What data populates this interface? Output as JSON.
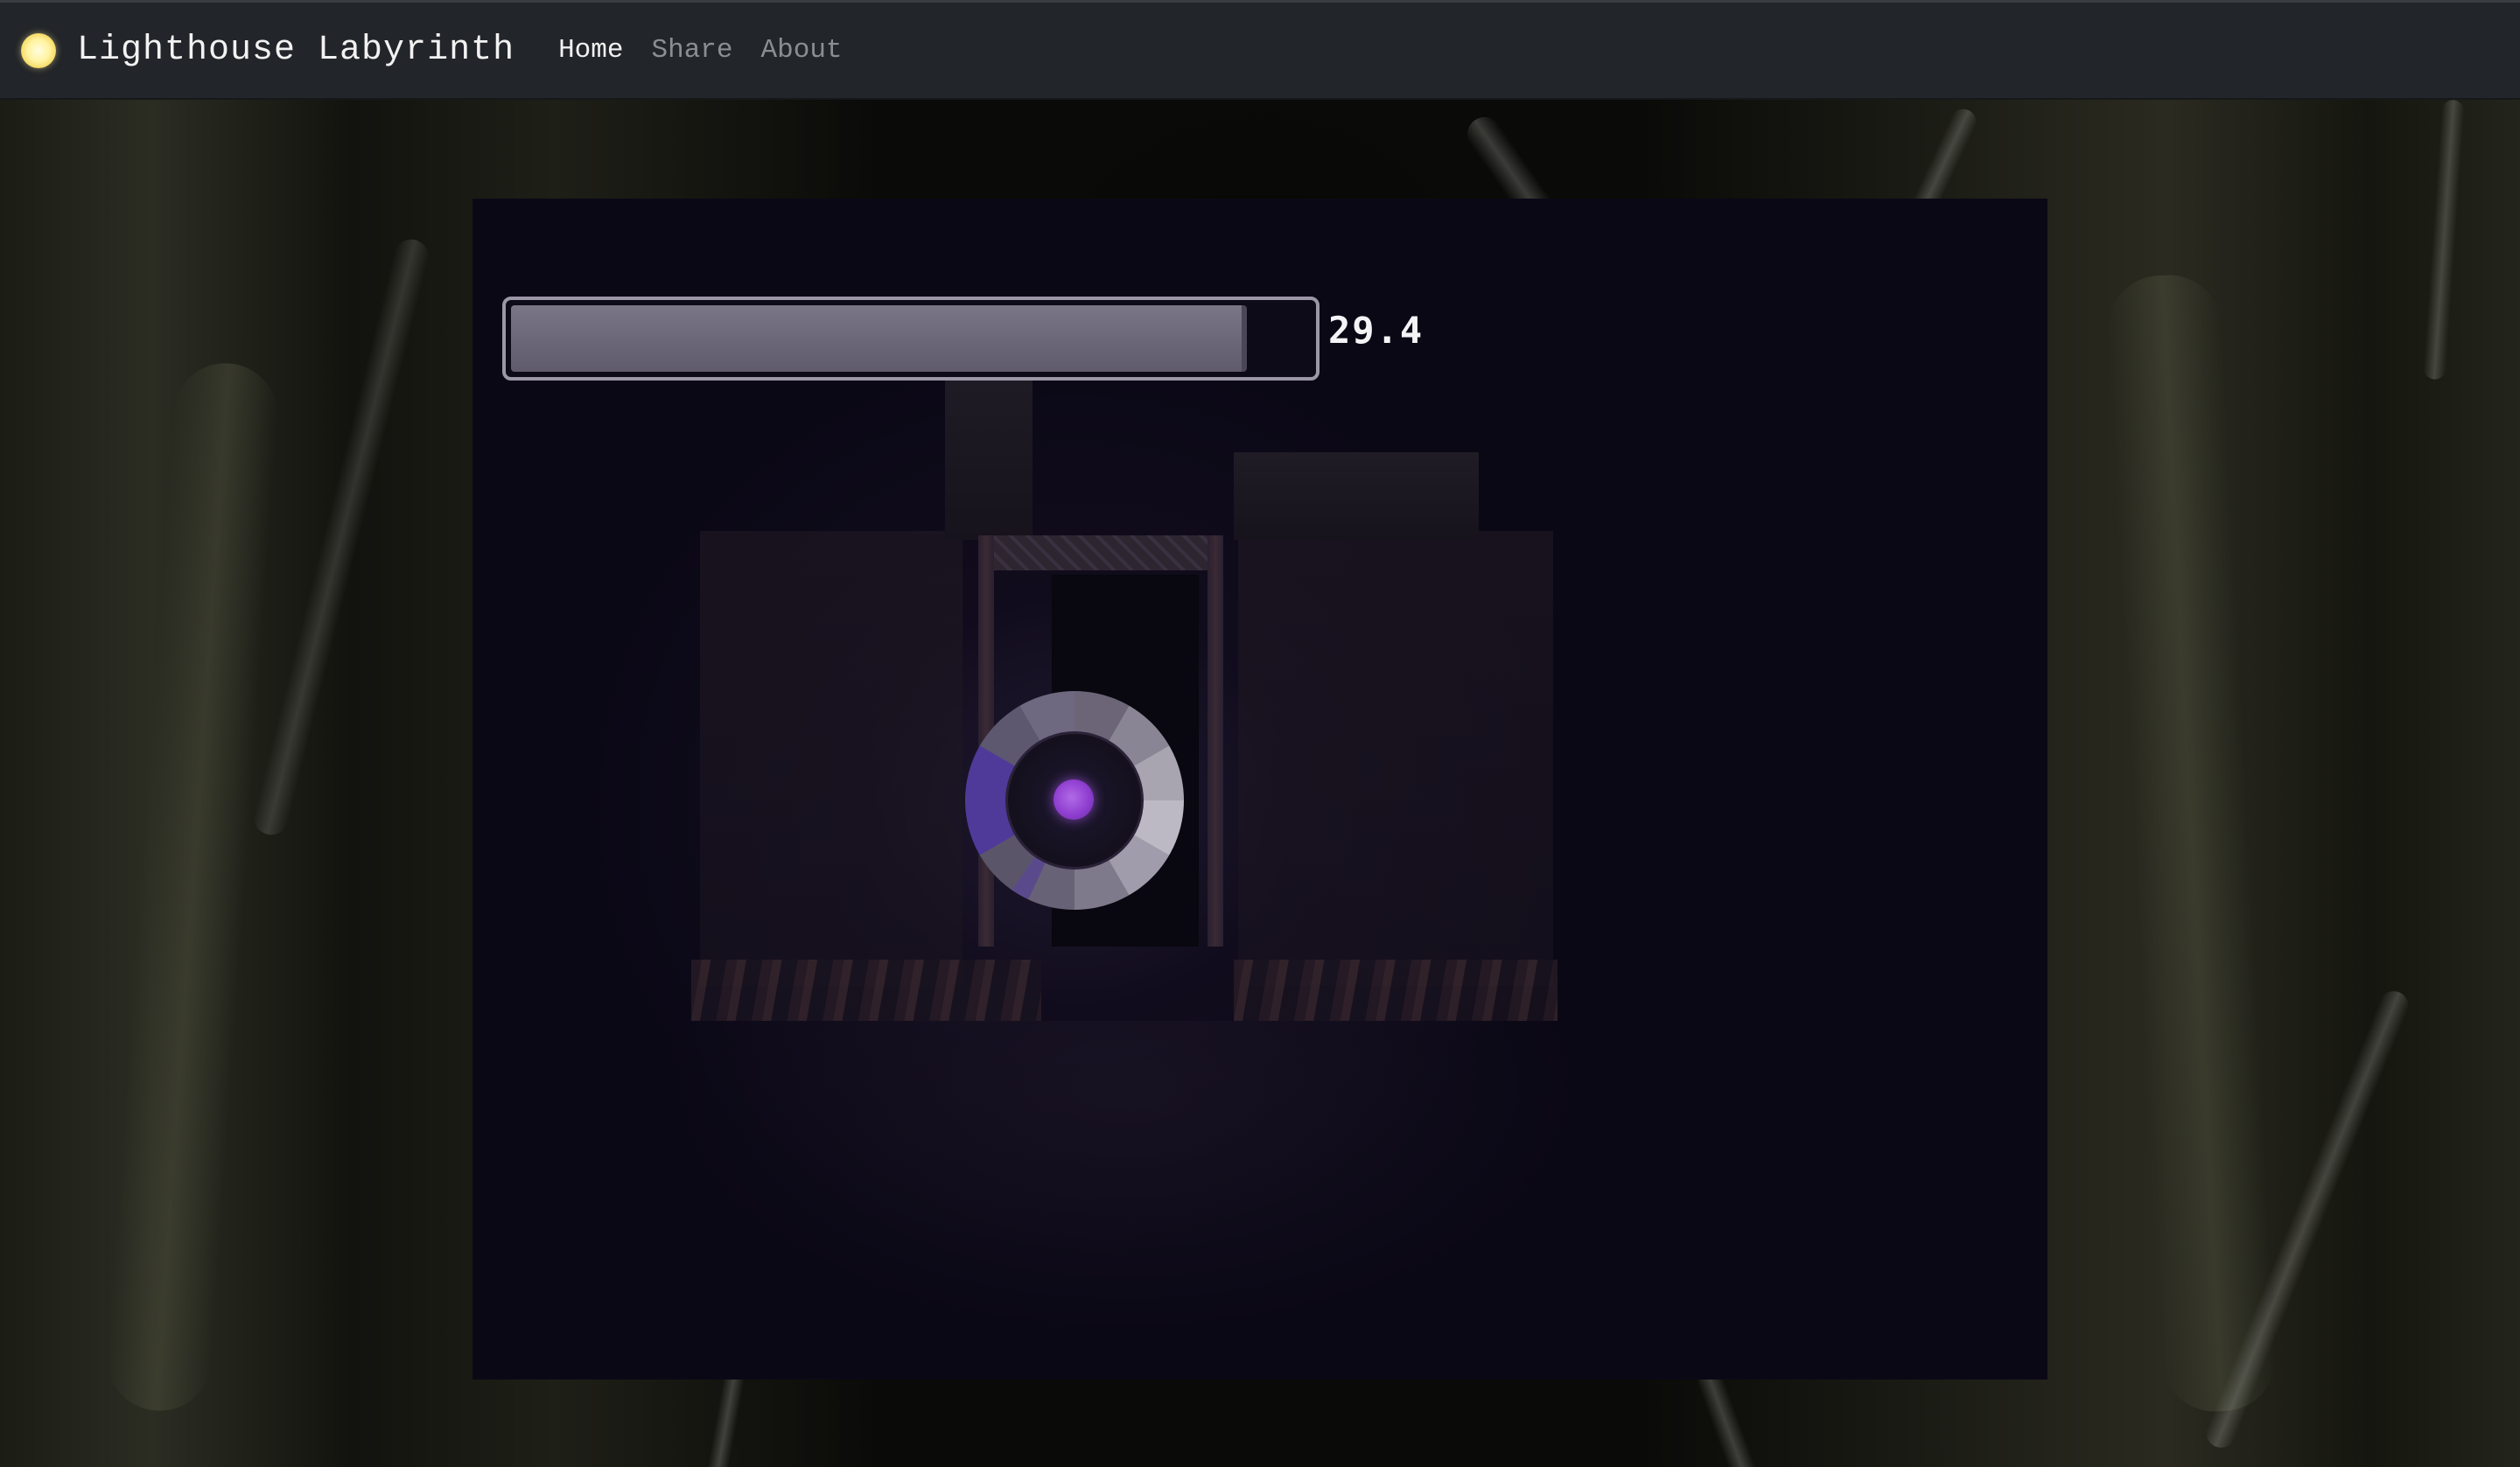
{
  "header": {
    "logo_icon": "lighthouse-light-icon",
    "title": "Lighthouse Labyrinth",
    "nav": [
      {
        "label": "Home",
        "active": true
      },
      {
        "label": "Share",
        "active": false
      },
      {
        "label": "About",
        "active": false
      }
    ]
  },
  "game": {
    "health_bar": {
      "fill_fraction": 0.92,
      "value_text": "29.4"
    },
    "player": {
      "icon": "light-orb-player",
      "core_color": "#9b4fdc"
    }
  },
  "colors": {
    "navbar": "#222529",
    "canvas_bg": "#0b0816",
    "bar_fill": "#6c6879",
    "bar_border": "#9b97a6"
  }
}
